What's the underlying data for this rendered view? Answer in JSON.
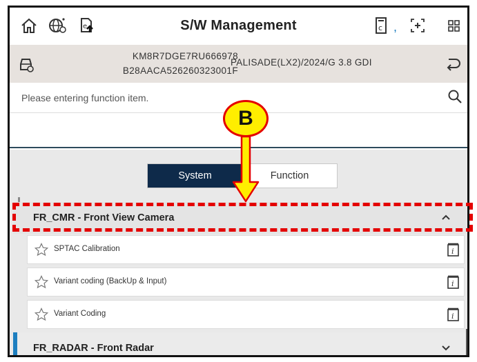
{
  "header": {
    "title": "S/W Management",
    "icons": [
      "home-icon",
      "globe-settings-icon",
      "upload-doc-icon",
      "clipboard-c-icon",
      "expand-icon",
      "grid-icon"
    ]
  },
  "vehicle": {
    "vin": "KM8R7DGE7RU666978",
    "code": "B28AACA526260323001F",
    "model": "PALISADE(LX2)/2024/G 3.8 GDI"
  },
  "search": {
    "placeholder": "Please entering function item."
  },
  "tabs": [
    {
      "label": "System",
      "active": true
    },
    {
      "label": "Function",
      "active": false
    }
  ],
  "groups": [
    {
      "label": "FR_CMR - Front View Camera",
      "expanded": true,
      "items": [
        {
          "label": "SPTAC Calibration"
        },
        {
          "label": "Variant coding (BackUp & Input)"
        },
        {
          "label": "Variant Coding"
        }
      ]
    },
    {
      "label": "FR_RADAR - Front Radar",
      "expanded": false,
      "items": []
    }
  ],
  "annotation": {
    "callout_letter": "B",
    "color": "#e40000",
    "callout_fill": "#ffee00"
  },
  "colors": {
    "tab_active": "#0e2a4a",
    "vehicle_bar": "#e7e2de",
    "accent_blue": "#1e7fc0"
  }
}
